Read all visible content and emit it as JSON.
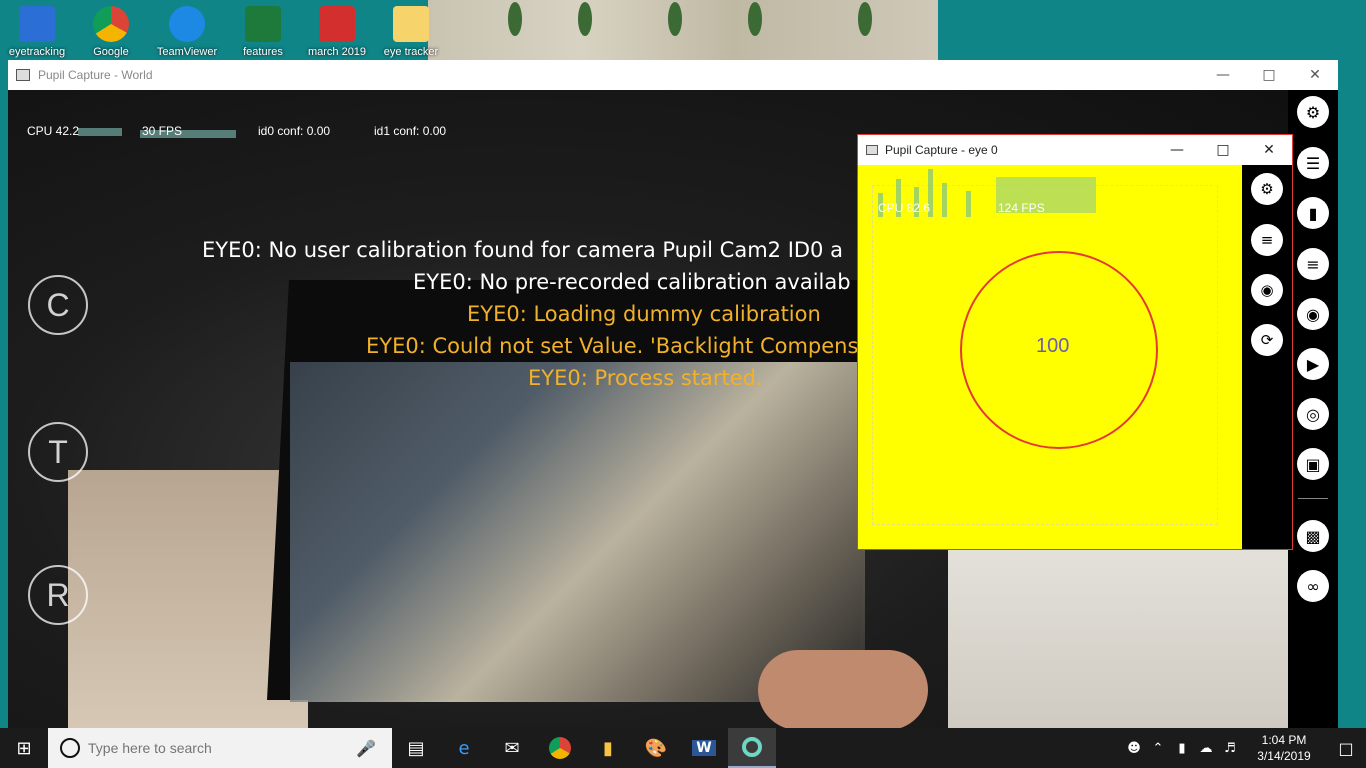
{
  "desktop": {
    "icons": [
      {
        "label": "eyetracking",
        "color": "#2b6fd6"
      },
      {
        "label": "Google",
        "color": "#f4b400"
      },
      {
        "label": "TeamViewer",
        "color": "#1e88e5"
      },
      {
        "label": "features",
        "color": "#1d7a3a"
      },
      {
        "label": "march 2019",
        "color": "#d32f2f"
      },
      {
        "label": "eye tracker",
        "color": "#f6d36b"
      }
    ]
  },
  "world_window": {
    "title": "Pupil Capture - World",
    "stats": {
      "cpu": "CPU 42.2",
      "fps": "30 FPS",
      "id0": "id0 conf: 0.00",
      "id1": "id1 conf: 0.00"
    },
    "side_buttons": [
      "C",
      "T",
      "R"
    ],
    "log_lines": [
      {
        "text": "EYE0: No user calibration found for camera Pupil Cam2 ID0 a",
        "color": "white"
      },
      {
        "text": "EYE0: No pre-recorded calibration availab",
        "color": "white"
      },
      {
        "text": "EYE0: Loading dummy calibration",
        "color": "orange"
      },
      {
        "text": "EYE0: Could not set Value. 'Backlight Compens",
        "color": "orange"
      },
      {
        "text": "EYE0: Process started.",
        "color": "orange"
      }
    ],
    "menu_icons": [
      "gear-icon",
      "sliders-icon",
      "bar-chart-icon",
      "list-icon",
      "camera-icon",
      "video-icon",
      "target-icon",
      "focus-icon",
      "cast-icon",
      "link-icon"
    ]
  },
  "eye_window": {
    "title": "Pupil Capture - eye 0",
    "stats": {
      "cpu": "CPU 82.6",
      "fps": "124 FPS"
    },
    "pupil_value": "100",
    "menu_icons": [
      "gear-icon",
      "list-icon",
      "camera-icon",
      "3d-icon"
    ]
  },
  "taskbar": {
    "search_placeholder": "Type here to search",
    "clock_time": "1:04 PM",
    "clock_date": "3/14/2019"
  }
}
